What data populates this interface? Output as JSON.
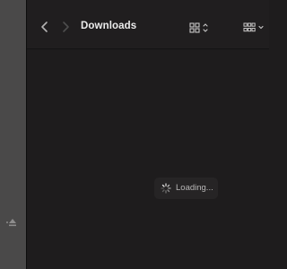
{
  "window": {
    "title": "Downloads"
  },
  "toolbar": {
    "back_icon": "chevron-left-icon",
    "forward_icon": "chevron-right-icon",
    "view_icon": "icon-grid-view-icon",
    "group_icon": "group-by-icon"
  },
  "content": {
    "loading_text": "Loading..."
  },
  "sidebar": {
    "eject_icon": "eject-icon"
  },
  "colors": {
    "background": "#1e1c1d",
    "sidebar": "#4a4949",
    "title_text": "#ececec",
    "muted_icon": "#8d8c8c"
  }
}
